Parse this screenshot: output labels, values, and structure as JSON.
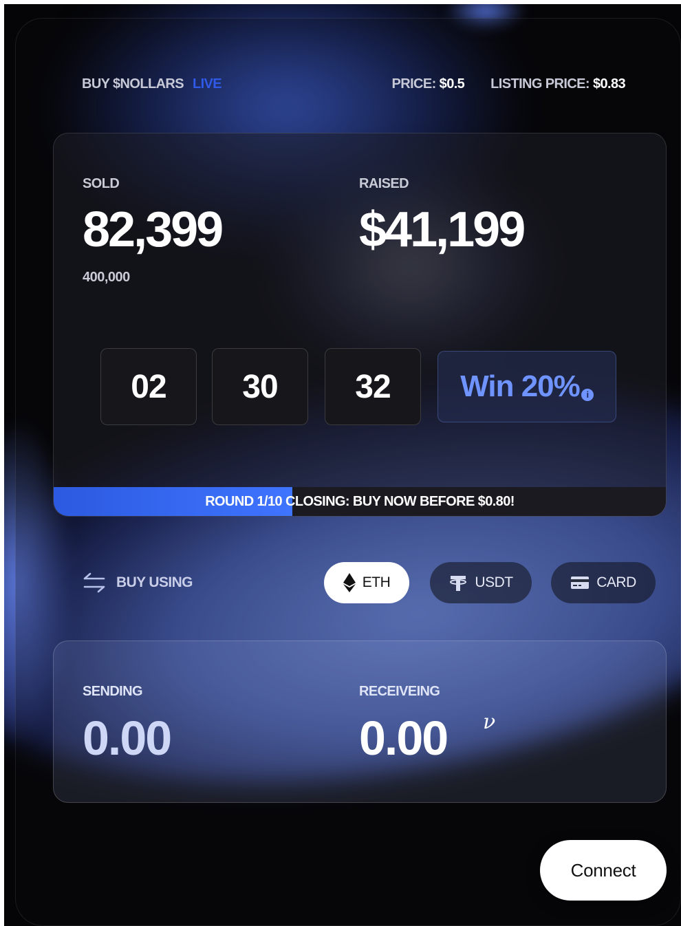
{
  "header": {
    "buy_label": "BUY $NOLLARS",
    "live_label": "LIVE",
    "price_label": "PRICE:",
    "price_value": "$0.5",
    "listing_label": "LISTING PRICE:",
    "listing_value": "$0.83"
  },
  "stats": {
    "sold_label": "SOLD",
    "sold_value": "82,399",
    "sold_total": "400,000",
    "raised_label": "RAISED",
    "raised_value": "$41,199"
  },
  "countdown": [
    "02",
    "30",
    "32"
  ],
  "win": {
    "label": "Win 20%",
    "info": "i"
  },
  "progress": {
    "text": "ROUND 1/10 CLOSING: BUY NOW BEFORE $0.80!",
    "fraction": 0.39,
    "color": "#2f5ef0"
  },
  "payment": {
    "label": "BUY USING",
    "options": [
      {
        "label": "ETH",
        "icon": "eth-icon",
        "selected": true
      },
      {
        "label": "USDT",
        "icon": "tether-icon",
        "selected": false
      },
      {
        "label": "CARD",
        "icon": "card-icon",
        "selected": false
      }
    ]
  },
  "exchange": {
    "sending_label": "SENDING",
    "sending_value": "0.00",
    "receiving_label": "RECEIVEING",
    "receiving_value": "0.00",
    "token_symbol": "ν"
  },
  "actions": {
    "connect_label": "Connect"
  },
  "colors": {
    "accent": "#2f59e6",
    "win_text": "#6f93ff",
    "background": "#050507"
  }
}
